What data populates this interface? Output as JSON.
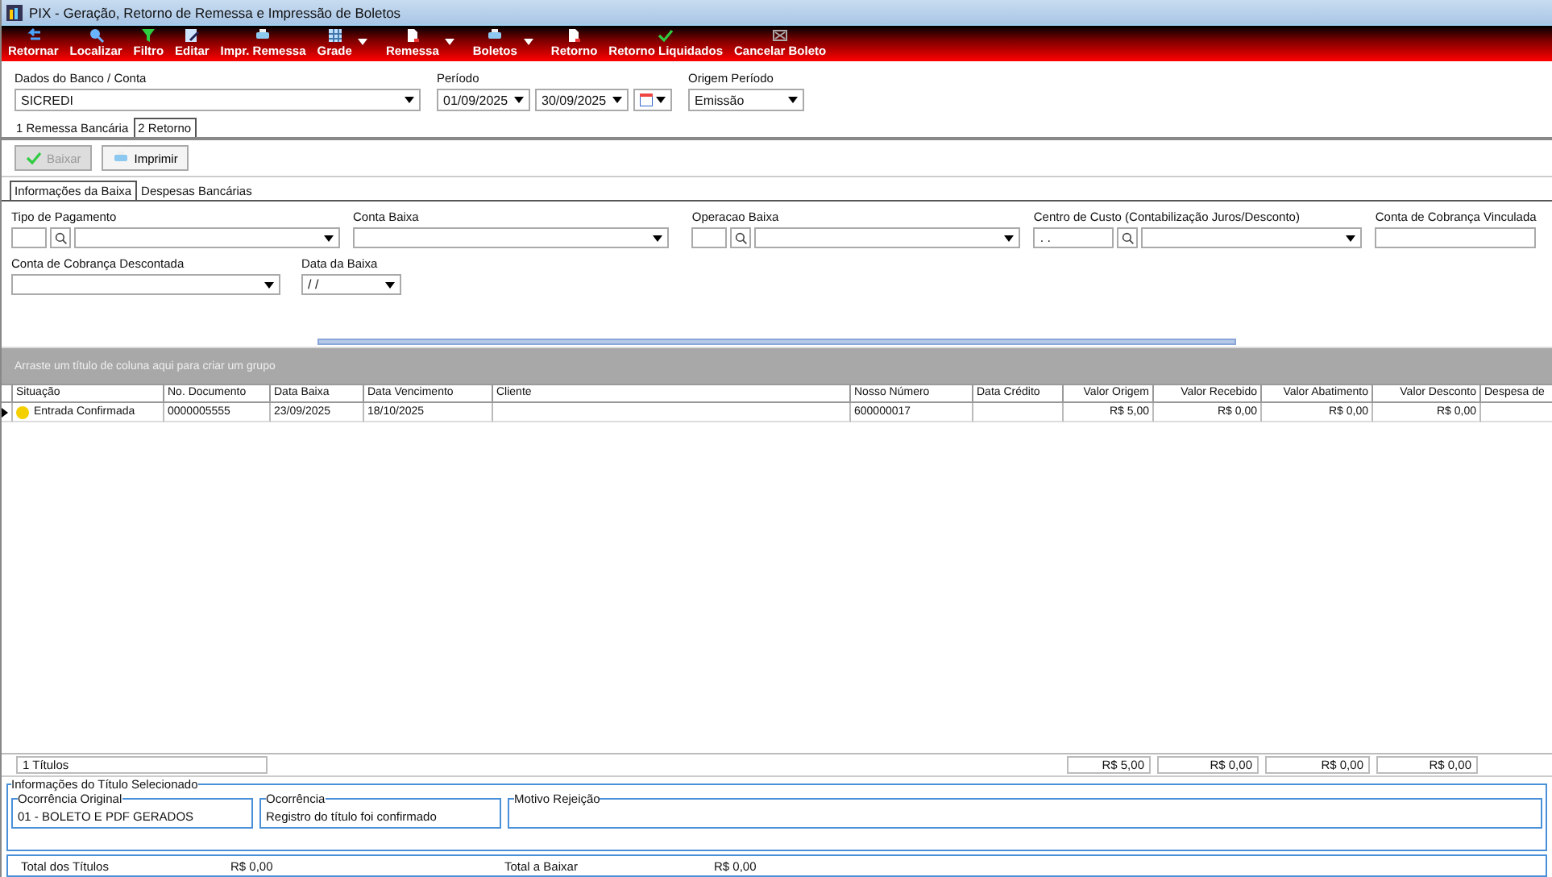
{
  "window": {
    "title": "PIX - Geração, Retorno de Remessa e Impressão de Boletos"
  },
  "toolbar": [
    {
      "label": "Retornar",
      "dropdown": false
    },
    {
      "label": "Localizar",
      "dropdown": false
    },
    {
      "label": "Filtro",
      "dropdown": false
    },
    {
      "label": "Editar",
      "dropdown": false
    },
    {
      "label": "Impr. Remessa",
      "dropdown": false
    },
    {
      "label": "Grade",
      "dropdown": true
    },
    {
      "label": "Remessa",
      "dropdown": true
    },
    {
      "label": "Boletos",
      "dropdown": true
    },
    {
      "label": "Retorno",
      "dropdown": false
    },
    {
      "label": "Retorno Liquidados",
      "dropdown": false
    },
    {
      "label": "Cancelar Boleto",
      "dropdown": false
    }
  ],
  "filters": {
    "bank": {
      "label": "Dados do Banco / Conta",
      "value": "SICREDI"
    },
    "period": {
      "label": "Período",
      "start": "01/09/2025",
      "end": "30/09/2025"
    },
    "origin": {
      "label": "Origem Período",
      "value": "Emissão"
    }
  },
  "tabs": [
    {
      "label": "1 Remessa Bancária",
      "selected": false
    },
    {
      "label": "2 Retorno",
      "selected": true
    }
  ],
  "actions": [
    {
      "label": "Baixar",
      "disabled": true
    },
    {
      "label": "Imprimir",
      "disabled": false
    }
  ],
  "subtabs": [
    {
      "label": "Informações da Baixa",
      "selected": true
    },
    {
      "label": "Despesas Bancárias",
      "selected": false
    }
  ],
  "fields_row_1": [
    {
      "label": "Tipo de Pagamento",
      "kind": "lookup"
    },
    {
      "label": "Conta Baixa",
      "kind": "combo"
    },
    {
      "label": "Operacao Baixa",
      "kind": "lookup"
    },
    {
      "label": "Centro de Custo (Contabilização Juros/Desconto)",
      "kind": "lookup",
      "value": ". ."
    },
    {
      "label": "Conta de Cobrança Vinculada",
      "kind": "text"
    }
  ],
  "fields_row_2": [
    {
      "label": "Conta de Cobrança Descontada",
      "kind": "combo"
    },
    {
      "label": "Data da Baixa",
      "kind": "date",
      "value": "/ /"
    }
  ],
  "grid": {
    "group_hint": "Arraste um título de coluna aqui para criar um grupo",
    "columns": [
      {
        "label": "Situação",
        "kind": "text"
      },
      {
        "label": "No. Documento",
        "kind": "text"
      },
      {
        "label": "Data Baixa",
        "kind": "text"
      },
      {
        "label": "Data Vencimento",
        "kind": "text"
      },
      {
        "label": "Cliente",
        "kind": "text"
      },
      {
        "label": "Nosso Número",
        "kind": "text"
      },
      {
        "label": "Data Crédito",
        "kind": "text"
      },
      {
        "label": "Valor Origem",
        "kind": "money",
        "total": "R$ 5,00"
      },
      {
        "label": "Valor Recebido",
        "kind": "money",
        "total": "R$ 0,00"
      },
      {
        "label": "Valor Abatimento",
        "kind": "money",
        "total": "R$ 0,00"
      },
      {
        "label": "Valor Desconto",
        "kind": "money",
        "total": "R$ 0,00"
      },
      {
        "label": "Despesa de",
        "kind": "text"
      }
    ],
    "rows": [
      {
        "current": true,
        "color": "#f5d000",
        "cells": [
          "Entrada Confirmada",
          "0000005555",
          "23/09/2025",
          "18/10/2025",
          "",
          "600000017",
          "",
          "R$ 5,00",
          "R$ 0,00",
          "R$ 0,00",
          "R$ 0,00",
          ""
        ]
      }
    ],
    "count": "1 Títulos"
  },
  "selected_info": {
    "title": "Informações do Título Selecionado",
    "boxes": [
      {
        "title": "Ocorrência Original",
        "text": "01 - BOLETO E PDF GERADOS"
      },
      {
        "title": "Ocorrência",
        "text": "Registro do título foi confirmado"
      },
      {
        "title": "Motivo Rejeição"
      }
    ]
  },
  "totals": [
    {
      "label": "Total dos Títulos",
      "value": "R$ 0,00"
    },
    {
      "label": "Total a Baixar",
      "value": "R$ 0,00"
    }
  ]
}
